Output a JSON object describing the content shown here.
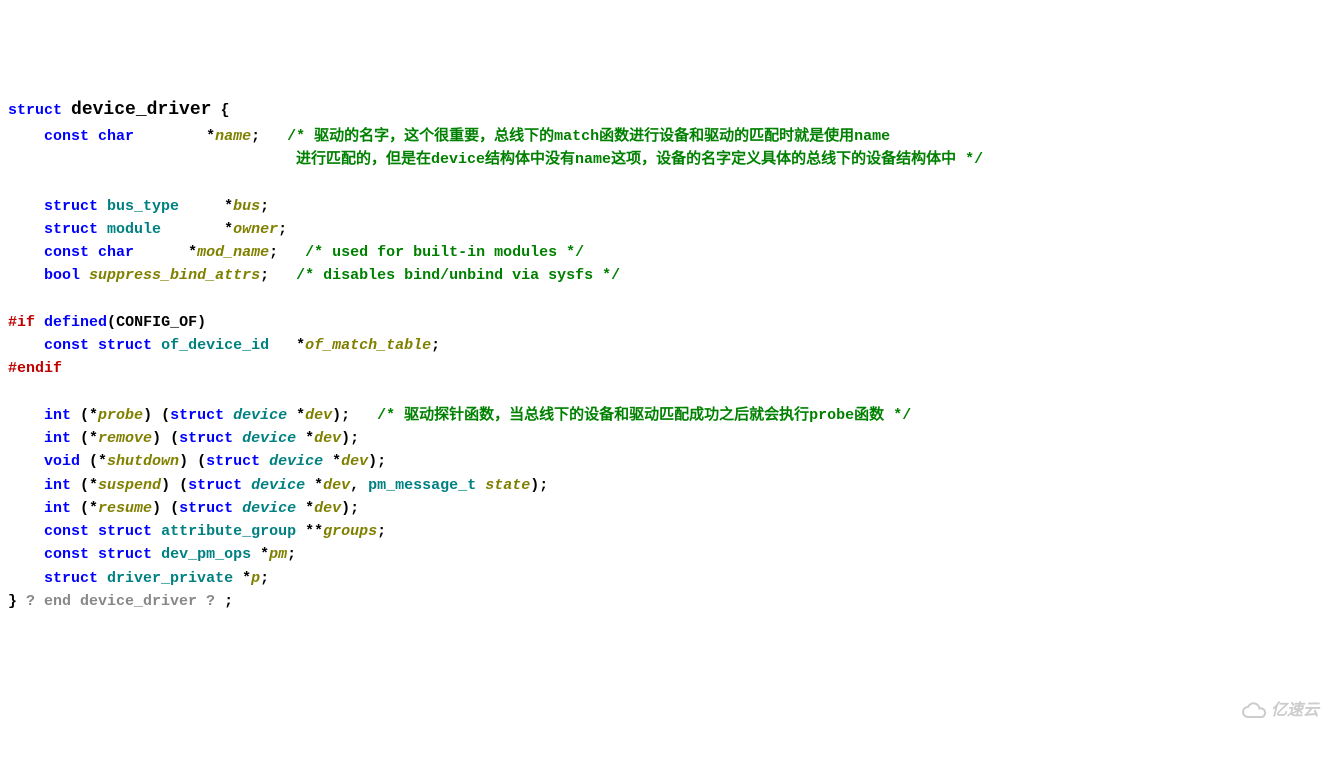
{
  "l1": {
    "k1": "struct",
    "ty": "device_driver",
    "p1": " {"
  },
  "l2": {
    "k1": "const",
    "k2": "char",
    "star": "*",
    "f": "name",
    "p": ";   ",
    "c": "/* 驱动的名字，这个很重要，总线下的match函数进行设备和驱动的匹配时就是使用name"
  },
  "l3": {
    "c": "进行匹配的，但是在device结构体中没有name这项，设备的名字定义具体的总线下的设备结构体中 */"
  },
  "l5": {
    "k1": "struct",
    "ty": "bus_type",
    "star": "*",
    "f": "bus",
    "p": ";"
  },
  "l6": {
    "k1": "struct",
    "ty": "module",
    "star": "*",
    "f": "owner",
    "p": ";"
  },
  "l7": {
    "k1": "const",
    "k2": "char",
    "star": "*",
    "f": "mod_name",
    "p": ";   ",
    "c": "/* used for built-in modules */"
  },
  "l8": {
    "k1": "bool",
    "f": "suppress_bind_attrs",
    "p": ";   ",
    "c": "/* disables bind/unbind via sysfs */"
  },
  "l10": {
    "a": "#if",
    "b": "defined",
    "c": "(",
    "d": "CONFIG_OF",
    "e": ")"
  },
  "l11": {
    "k1": "const",
    "k2": "struct",
    "ty": "of_device_id",
    "star": "*",
    "f": "of_match_table",
    "p": ";"
  },
  "l12": {
    "a": "#endif"
  },
  "l14": {
    "k1": "int",
    "p1": " (*",
    "f": "probe",
    "p2": ") (",
    "k2": "struct",
    "ty": "device",
    "star": " *",
    "arg": "dev",
    "p3": ");   ",
    "c": "/* 驱动探针函数，当总线下的设备和驱动匹配成功之后就会执行probe函数 */"
  },
  "l15": {
    "k1": "int",
    "p1": " (*",
    "f": "remove",
    "p2": ") (",
    "k2": "struct",
    "ty": "device",
    "star": " *",
    "arg": "dev",
    "p3": ");"
  },
  "l16": {
    "k1": "void",
    "p1": " (*",
    "f": "shutdown",
    "p2": ") (",
    "k2": "struct",
    "ty": "device",
    "star": " *",
    "arg": "dev",
    "p3": ");"
  },
  "l17": {
    "k1": "int",
    "p1": " (*",
    "f": "suspend",
    "p2": ") (",
    "k2": "struct",
    "ty": "device",
    "star": " *",
    "arg": "dev",
    "p3": ", ",
    "ty2": "pm_message_t",
    "sp": " ",
    "arg2": "state",
    "p4": ");"
  },
  "l18": {
    "k1": "int",
    "p1": " (*",
    "f": "resume",
    "p2": ") (",
    "k2": "struct",
    "ty": "device",
    "star": " *",
    "arg": "dev",
    "p3": ");"
  },
  "l19": {
    "k1": "const",
    "k2": "struct",
    "ty": "attribute_group",
    "star": " **",
    "f": "groups",
    "p": ";"
  },
  "l20": {
    "k1": "const",
    "k2": "struct",
    "ty": "dev_pm_ops",
    "star": " *",
    "f": "pm",
    "p": ";"
  },
  "l21": {
    "k1": "struct",
    "ty": "driver_private",
    "star": " *",
    "f": "p",
    "pc": ";"
  },
  "l22": {
    "p1": "}",
    "g": " ? end device_driver ? ",
    "p2": ";"
  },
  "watermark": "亿速云"
}
